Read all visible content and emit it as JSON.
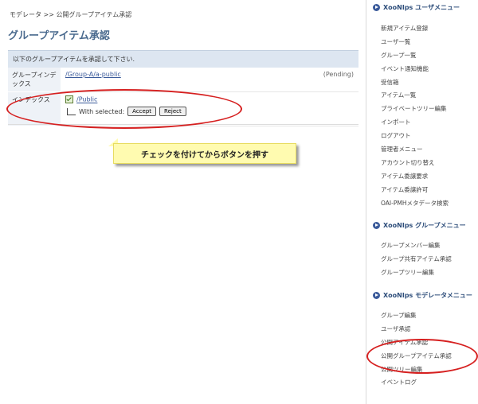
{
  "breadcrumb": "モデレータ >> 公開グループアイテム承認",
  "page_title": "グループアイテム承認",
  "panel": {
    "heading": "以下のグループアイテムを承認して下さい.",
    "group_index_label": "グループインデックス",
    "group_index_value": "/Group-A/a-public",
    "pending": "(Pending)",
    "index_label": "インデックス",
    "index_value": "/Public",
    "with_selected": "With selected:",
    "accept": "Accept",
    "reject": "Reject"
  },
  "callout": "チェックを付けてからボタンを押す",
  "sidebar": {
    "user_menu_title": "XooNIps ユーザメニュー",
    "user_menu": [
      "新規アイテム登録",
      "ユーザ一覧",
      "グループ一覧",
      "イベント通知機能",
      "受信箱",
      "アイテム一覧",
      "プライベートツリー編集",
      "インポート",
      "ログアウト",
      "管理者メニュー",
      "アカウント切り替え",
      "アイテム委譲要求",
      "アイテム委譲許可",
      "OAI-PMHメタデータ検索"
    ],
    "group_menu_title": "XooNIps グループメニュー",
    "group_menu": [
      "グループメンバー編集",
      "グループ共有アイテム承認",
      "グループツリー編集"
    ],
    "moderator_menu_title": "XooNIps モデレータメニュー",
    "moderator_menu": [
      "グループ編集",
      "ユーザ承認",
      "公開アイテム承認",
      "公開グループアイテム承認",
      "公開ツリー編集",
      "イベントログ"
    ]
  },
  "colors": {
    "highlight_ellipse": "#d62020",
    "callout_bg": "#fffbb0",
    "accent": "#3a5a9a"
  }
}
